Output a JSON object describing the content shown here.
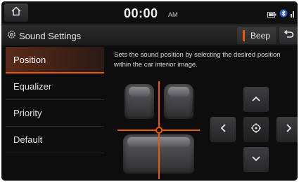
{
  "status": {
    "time": "00:00",
    "ampm": "AM"
  },
  "header": {
    "title": "Sound Settings",
    "beep_label": "Beep"
  },
  "sidebar": {
    "items": [
      {
        "label": "Position",
        "active": true
      },
      {
        "label": "Equalizer",
        "active": false
      },
      {
        "label": "Priority",
        "active": false
      },
      {
        "label": "Default",
        "active": false
      }
    ]
  },
  "main": {
    "description": "Sets the sound position by selecting the desired position within the car interior image."
  },
  "colors": {
    "accent": "#e8590c",
    "background": "#0d0d0e"
  },
  "icons": [
    "home-icon",
    "gear-icon",
    "battery-icon",
    "bluetooth-icon",
    "signal-icon",
    "back-icon",
    "chevron-up-icon",
    "chevron-down-icon",
    "chevron-left-icon",
    "chevron-right-icon",
    "crosshair-icon"
  ]
}
